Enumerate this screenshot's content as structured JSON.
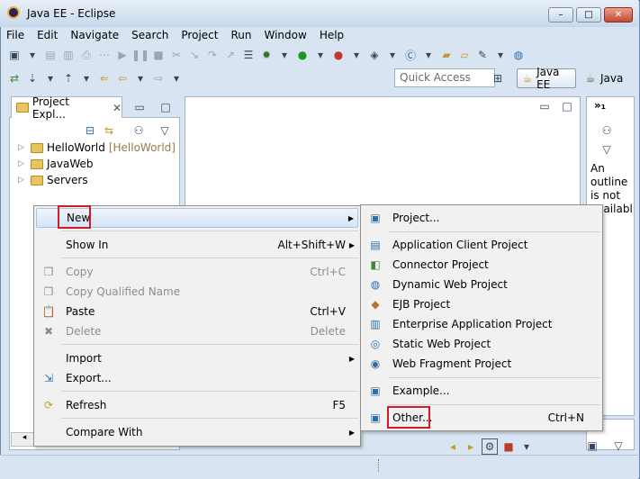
{
  "window": {
    "title": "Java EE - Eclipse",
    "controls": {
      "minimize": "–",
      "maximize": "□",
      "close": "✕"
    }
  },
  "menubar": [
    "File",
    "Edit",
    "Navigate",
    "Search",
    "Project",
    "Run",
    "Window",
    "Help"
  ],
  "toolbar": {
    "quick_access_placeholder": "Quick Access",
    "perspectives": [
      {
        "label": "Java EE",
        "active": true
      },
      {
        "label": "Java",
        "active": false
      }
    ]
  },
  "project_explorer": {
    "tab_label": "Project Expl...",
    "tree": [
      {
        "name": "HelloWorld",
        "decoration": "[HelloWorld]"
      },
      {
        "name": "JavaWeb",
        "decoration": ""
      },
      {
        "name": "Servers",
        "decoration": ""
      }
    ]
  },
  "outline": {
    "tab_label": "»₁",
    "message_lines": [
      "An",
      "outline",
      "is not",
      "availabl"
    ]
  },
  "context_menu": {
    "items": [
      {
        "label": "New",
        "shortcut": "",
        "submenu": true,
        "enabled": true,
        "highlighted": true,
        "icon": ""
      },
      {
        "label": "Show In",
        "shortcut": "Alt+Shift+W",
        "submenu": true,
        "enabled": true,
        "icon": ""
      },
      {
        "label": "Copy",
        "shortcut": "Ctrl+C",
        "enabled": false,
        "icon": "copy-icon"
      },
      {
        "label": "Copy Qualified Name",
        "shortcut": "",
        "enabled": false,
        "icon": "copy-qualified-icon"
      },
      {
        "label": "Paste",
        "shortcut": "Ctrl+V",
        "enabled": true,
        "icon": "paste-icon"
      },
      {
        "label": "Delete",
        "shortcut": "Delete",
        "enabled": false,
        "icon": "delete-icon"
      },
      {
        "label": "Import",
        "shortcut": "",
        "submenu": true,
        "enabled": true,
        "icon": ""
      },
      {
        "label": "Export...",
        "shortcut": "",
        "enabled": true,
        "icon": "export-icon"
      },
      {
        "label": "Refresh",
        "shortcut": "F5",
        "enabled": true,
        "icon": "refresh-icon"
      },
      {
        "label": "Compare With",
        "shortcut": "",
        "submenu": true,
        "enabled": true,
        "icon": ""
      }
    ]
  },
  "new_submenu": {
    "items": [
      {
        "label": "Project...",
        "icon": "new-project-icon"
      },
      {
        "label": "Application Client Project",
        "icon": "app-client-project-icon"
      },
      {
        "label": "Connector Project",
        "icon": "connector-project-icon"
      },
      {
        "label": "Dynamic Web Project",
        "icon": "dynamic-web-project-icon"
      },
      {
        "label": "EJB Project",
        "icon": "ejb-project-icon"
      },
      {
        "label": "Enterprise Application Project",
        "icon": "enterprise-app-project-icon"
      },
      {
        "label": "Static Web Project",
        "icon": "static-web-project-icon"
      },
      {
        "label": "Web Fragment Project",
        "icon": "web-fragment-project-icon"
      },
      {
        "label": "Example...",
        "icon": "example-icon"
      },
      {
        "label": "Other...",
        "shortcut": "Ctrl+N",
        "icon": "other-wizard-icon"
      }
    ]
  },
  "colors": {
    "highlight_box": "#d21b25",
    "window_bg": "#d8e4f1"
  }
}
